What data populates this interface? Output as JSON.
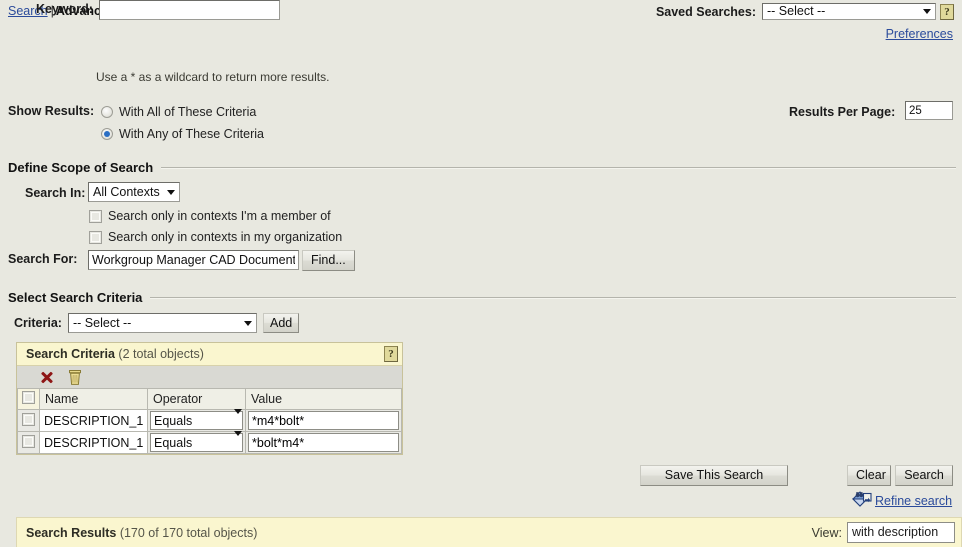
{
  "breadcrumb": {
    "search_link": "Search",
    "separator": "|",
    "current": "Advanced Search"
  },
  "saved_searches": {
    "label": "Saved Searches:",
    "selected": "-- Select --",
    "help_glyph": "?",
    "preferences_link": "Preferences"
  },
  "keyword": {
    "label": "Keyword:",
    "value": "",
    "placeholder": "",
    "hint": "Use a * as a wildcard to return more results."
  },
  "show_results": {
    "label": "Show Results:",
    "options": [
      {
        "label": "With All of These Criteria",
        "checked": false
      },
      {
        "label": "With Any of These Criteria",
        "checked": true
      }
    ]
  },
  "results_per_page": {
    "label": "Results Per Page:",
    "value": "25"
  },
  "scope": {
    "section_title": "Define Scope of Search",
    "search_in_label": "Search In:",
    "search_in_selected": "All Contexts",
    "checkbox_member_label": "Search only in contexts I'm a member of",
    "checkbox_member_checked": false,
    "checkbox_org_label": "Search only in contexts in my organization",
    "checkbox_org_checked": false,
    "search_for_label": "Search For:",
    "search_for_value": "Workgroup Manager CAD Document",
    "find_button": "Find..."
  },
  "criteria_section": {
    "section_title": "Select Search Criteria",
    "criteria_label": "Criteria:",
    "criteria_selected": "-- Select --",
    "add_button": "Add"
  },
  "criteria_panel": {
    "title": "Search Criteria",
    "count": "(2 total objects)",
    "help_glyph": "?",
    "toolbar": {
      "delete_icon": "red-x-icon",
      "trash_icon": "trash-icon"
    },
    "columns": [
      "Name",
      "Operator",
      "Value"
    ],
    "rows": [
      {
        "checked": false,
        "name": "DESCRIPTION_1",
        "operator": "Equals",
        "value": "*m4*bolt*"
      },
      {
        "checked": false,
        "name": "DESCRIPTION_1",
        "operator": "Equals",
        "value": "*bolt*m4*"
      }
    ]
  },
  "actions": {
    "save_this_search": "Save This Search",
    "clear": "Clear",
    "search": "Search",
    "refine_search": "Refine search",
    "refine_icon": "refine-search-icon"
  },
  "results": {
    "title": "Search Results",
    "count": "(170 of 170 total objects)",
    "view_label": "View:",
    "view_selected": "with description"
  },
  "colors": {
    "page_background": "#e8e8e0",
    "panel_yellow": "#faf6cf",
    "link_blue": "#2b4b9b",
    "accent_red": "#8e1616",
    "help_yellow": "#e0d99b"
  }
}
